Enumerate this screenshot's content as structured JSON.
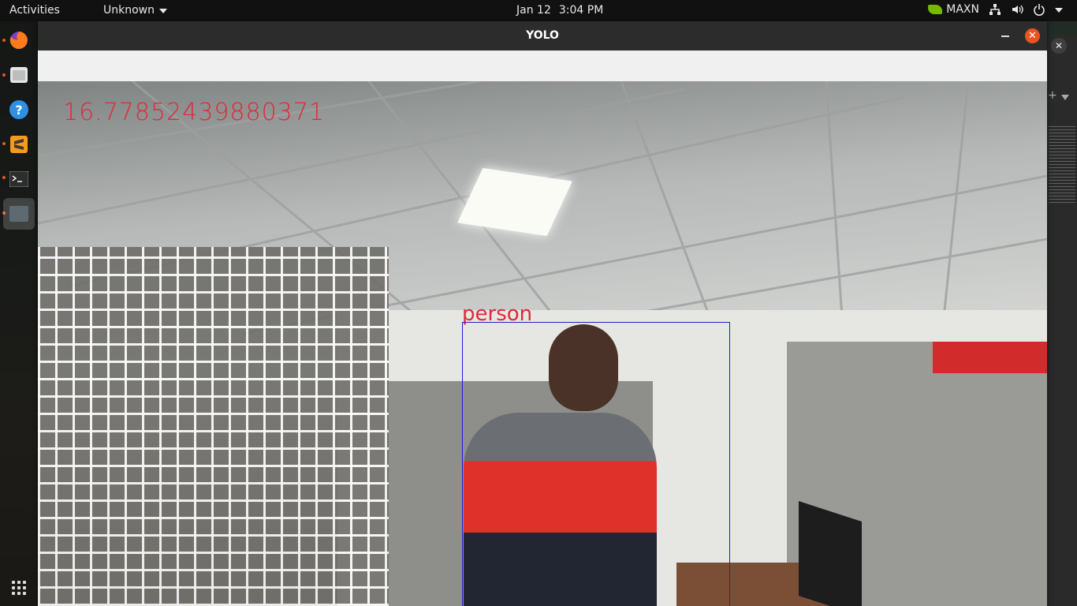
{
  "topbar": {
    "activities": "Activities",
    "app_menu": "Unknown",
    "date": "Jan 12",
    "time": "3:04 PM",
    "power_mode": "MAXN",
    "icons": [
      "nvidia-icon",
      "network-icon",
      "volume-icon",
      "power-icon",
      "chevron-down-icon"
    ]
  },
  "dock": {
    "items": [
      "firefox-icon",
      "files-icon",
      "help-icon",
      "sublime-text-icon",
      "terminal-icon",
      "active-window-icon"
    ],
    "apps_icon": "show-applications-icon"
  },
  "window": {
    "title": "YOLO",
    "close_glyph": "✕"
  },
  "overlay": {
    "fps_value": "16.77852439880371",
    "detections": [
      {
        "label": "person"
      }
    ]
  },
  "colors": {
    "accent": "#e95420",
    "overlay_text": "#e0283a",
    "box": "#1a22d9"
  }
}
